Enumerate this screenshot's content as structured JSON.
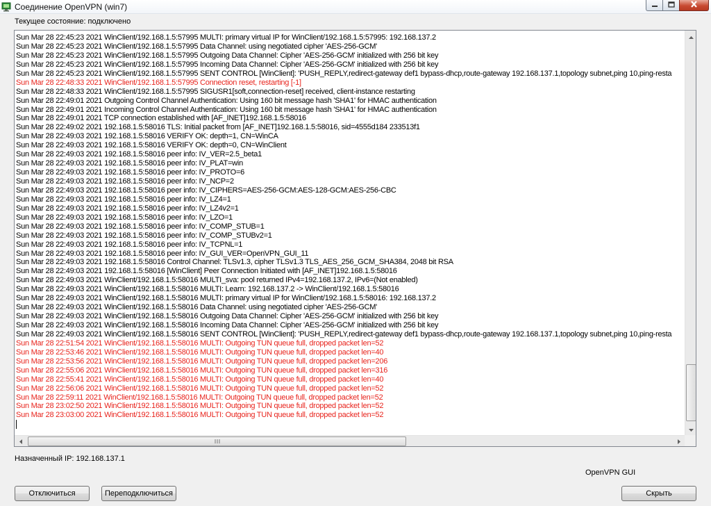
{
  "window": {
    "title": "Соединение OpenVPN (win7)"
  },
  "status": {
    "state_text": "Текущее состояние: подключено"
  },
  "log_lines": [
    {
      "text": "Sun Mar 28 22:45:23 2021 WinClient/192.168.1.5:57995 MULTI: primary virtual IP for WinClient/192.168.1.5:57995: 192.168.137.2",
      "error": false
    },
    {
      "text": "Sun Mar 28 22:45:23 2021 WinClient/192.168.1.5:57995 Data Channel: using negotiated cipher 'AES-256-GCM'",
      "error": false
    },
    {
      "text": "Sun Mar 28 22:45:23 2021 WinClient/192.168.1.5:57995 Outgoing Data Channel: Cipher 'AES-256-GCM' initialized with 256 bit key",
      "error": false
    },
    {
      "text": "Sun Mar 28 22:45:23 2021 WinClient/192.168.1.5:57995 Incoming Data Channel: Cipher 'AES-256-GCM' initialized with 256 bit key",
      "error": false
    },
    {
      "text": "Sun Mar 28 22:45:23 2021 WinClient/192.168.1.5:57995 SENT CONTROL [WinClient]: 'PUSH_REPLY,redirect-gateway def1 bypass-dhcp,route-gateway 192.168.137.1,topology subnet,ping 10,ping-resta",
      "error": false
    },
    {
      "text": "Sun Mar 28 22:48:33 2021 WinClient/192.168.1.5:57995 Connection reset, restarting [-1]",
      "error": true
    },
    {
      "text": "Sun Mar 28 22:48:33 2021 WinClient/192.168.1.5:57995 SIGUSR1[soft,connection-reset] received, client-instance restarting",
      "error": false
    },
    {
      "text": "Sun Mar 28 22:49:01 2021 Outgoing Control Channel Authentication: Using 160 bit message hash 'SHA1' for HMAC authentication",
      "error": false
    },
    {
      "text": "Sun Mar 28 22:49:01 2021 Incoming Control Channel Authentication: Using 160 bit message hash 'SHA1' for HMAC authentication",
      "error": false
    },
    {
      "text": "Sun Mar 28 22:49:01 2021 TCP connection established with [AF_INET]192.168.1.5:58016",
      "error": false
    },
    {
      "text": "Sun Mar 28 22:49:02 2021 192.168.1.5:58016 TLS: Initial packet from [AF_INET]192.168.1.5:58016, sid=4555d184 233513f1",
      "error": false
    },
    {
      "text": "Sun Mar 28 22:49:03 2021 192.168.1.5:58016 VERIFY OK: depth=1, CN=WinCA",
      "error": false
    },
    {
      "text": "Sun Mar 28 22:49:03 2021 192.168.1.5:58016 VERIFY OK: depth=0, CN=WinClient",
      "error": false
    },
    {
      "text": "Sun Mar 28 22:49:03 2021 192.168.1.5:58016 peer info: IV_VER=2.5_beta1",
      "error": false
    },
    {
      "text": "Sun Mar 28 22:49:03 2021 192.168.1.5:58016 peer info: IV_PLAT=win",
      "error": false
    },
    {
      "text": "Sun Mar 28 22:49:03 2021 192.168.1.5:58016 peer info: IV_PROTO=6",
      "error": false
    },
    {
      "text": "Sun Mar 28 22:49:03 2021 192.168.1.5:58016 peer info: IV_NCP=2",
      "error": false
    },
    {
      "text": "Sun Mar 28 22:49:03 2021 192.168.1.5:58016 peer info: IV_CIPHERS=AES-256-GCM:AES-128-GCM:AES-256-CBC",
      "error": false
    },
    {
      "text": "Sun Mar 28 22:49:03 2021 192.168.1.5:58016 peer info: IV_LZ4=1",
      "error": false
    },
    {
      "text": "Sun Mar 28 22:49:03 2021 192.168.1.5:58016 peer info: IV_LZ4v2=1",
      "error": false
    },
    {
      "text": "Sun Mar 28 22:49:03 2021 192.168.1.5:58016 peer info: IV_LZO=1",
      "error": false
    },
    {
      "text": "Sun Mar 28 22:49:03 2021 192.168.1.5:58016 peer info: IV_COMP_STUB=1",
      "error": false
    },
    {
      "text": "Sun Mar 28 22:49:03 2021 192.168.1.5:58016 peer info: IV_COMP_STUBv2=1",
      "error": false
    },
    {
      "text": "Sun Mar 28 22:49:03 2021 192.168.1.5:58016 peer info: IV_TCPNL=1",
      "error": false
    },
    {
      "text": "Sun Mar 28 22:49:03 2021 192.168.1.5:58016 peer info: IV_GUI_VER=OpenVPN_GUI_11",
      "error": false
    },
    {
      "text": "Sun Mar 28 22:49:03 2021 192.168.1.5:58016 Control Channel: TLSv1.3, cipher TLSv1.3 TLS_AES_256_GCM_SHA384, 2048 bit RSA",
      "error": false
    },
    {
      "text": "Sun Mar 28 22:49:03 2021 192.168.1.5:58016 [WinClient] Peer Connection Initiated with [AF_INET]192.168.1.5:58016",
      "error": false
    },
    {
      "text": "Sun Mar 28 22:49:03 2021 WinClient/192.168.1.5:58016 MULTI_sva: pool returned IPv4=192.168.137.2, IPv6=(Not enabled)",
      "error": false
    },
    {
      "text": "Sun Mar 28 22:49:03 2021 WinClient/192.168.1.5:58016 MULTI: Learn: 192.168.137.2 -> WinClient/192.168.1.5:58016",
      "error": false
    },
    {
      "text": "Sun Mar 28 22:49:03 2021 WinClient/192.168.1.5:58016 MULTI: primary virtual IP for WinClient/192.168.1.5:58016: 192.168.137.2",
      "error": false
    },
    {
      "text": "Sun Mar 28 22:49:03 2021 WinClient/192.168.1.5:58016 Data Channel: using negotiated cipher 'AES-256-GCM'",
      "error": false
    },
    {
      "text": "Sun Mar 28 22:49:03 2021 WinClient/192.168.1.5:58016 Outgoing Data Channel: Cipher 'AES-256-GCM' initialized with 256 bit key",
      "error": false
    },
    {
      "text": "Sun Mar 28 22:49:03 2021 WinClient/192.168.1.5:58016 Incoming Data Channel: Cipher 'AES-256-GCM' initialized with 256 bit key",
      "error": false
    },
    {
      "text": "Sun Mar 28 22:49:03 2021 WinClient/192.168.1.5:58016 SENT CONTROL [WinClient]: 'PUSH_REPLY,redirect-gateway def1 bypass-dhcp,route-gateway 192.168.137.1,topology subnet,ping 10,ping-resta",
      "error": false
    },
    {
      "text": "Sun Mar 28 22:51:54 2021 WinClient/192.168.1.5:58016 MULTI: Outgoing TUN queue full, dropped packet len=52",
      "error": true
    },
    {
      "text": "Sun Mar 28 22:53:46 2021 WinClient/192.168.1.5:58016 MULTI: Outgoing TUN queue full, dropped packet len=40",
      "error": true
    },
    {
      "text": "Sun Mar 28 22:53:56 2021 WinClient/192.168.1.5:58016 MULTI: Outgoing TUN queue full, dropped packet len=206",
      "error": true
    },
    {
      "text": "Sun Mar 28 22:55:06 2021 WinClient/192.168.1.5:58016 MULTI: Outgoing TUN queue full, dropped packet len=316",
      "error": true
    },
    {
      "text": "Sun Mar 28 22:55:41 2021 WinClient/192.168.1.5:58016 MULTI: Outgoing TUN queue full, dropped packet len=40",
      "error": true
    },
    {
      "text": "Sun Mar 28 22:56:06 2021 WinClient/192.168.1.5:58016 MULTI: Outgoing TUN queue full, dropped packet len=52",
      "error": true
    },
    {
      "text": "Sun Mar 28 22:59:11 2021 WinClient/192.168.1.5:58016 MULTI: Outgoing TUN queue full, dropped packet len=52",
      "error": true
    },
    {
      "text": "Sun Mar 28 23:02:50 2021 WinClient/192.168.1.5:58016 MULTI: Outgoing TUN queue full, dropped packet len=52",
      "error": true
    },
    {
      "text": "Sun Mar 28 23:03:00 2021 WinClient/192.168.1.5:58016 MULTI: Outgoing TUN queue full, dropped packet len=52",
      "error": true
    }
  ],
  "footer": {
    "assigned_ip": "Назначенный IP: 192.168.137.1",
    "app_name": "OpenVPN GUI",
    "disconnect_label": "Отключиться",
    "reconnect_label": "Переподключиться",
    "hide_label": "Скрыть"
  },
  "colors": {
    "error_text": "#e8231c",
    "normal_text": "#000000",
    "window_bg": "#f0f0f0"
  },
  "icons": {
    "app": "openvpn-monitor-icon",
    "minimize": "minimize-icon",
    "maximize": "maximize-icon",
    "close": "close-icon"
  }
}
